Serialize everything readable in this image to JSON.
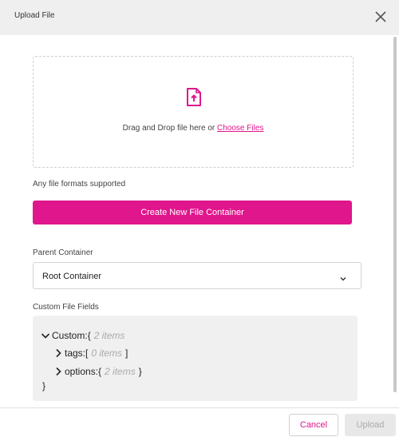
{
  "dialog": {
    "title": "Upload File"
  },
  "dropzone": {
    "prompt": "Drag and Drop file here or ",
    "choose_link": "Choose Files",
    "icon": "file-upload-icon"
  },
  "formats_note": "Any file formats supported",
  "create_button": "Create New File Container",
  "parent_container": {
    "label": "Parent Container",
    "selected": "Root Container"
  },
  "custom_fields": {
    "label": "Custom File Fields",
    "root": {
      "key": "Custom:",
      "open": "{",
      "count": "2 items",
      "close": "}"
    },
    "children": [
      {
        "key": "tags:",
        "open": "[",
        "count": "0 items",
        "close": "]"
      },
      {
        "key": "options:",
        "open": "{",
        "count": "2 items",
        "close": "}"
      }
    ]
  },
  "footer": {
    "cancel": "Cancel",
    "upload": "Upload"
  },
  "colors": {
    "accent": "#e0168c",
    "header_bg": "#efefef",
    "disabled_bg": "#e8e8e8"
  }
}
